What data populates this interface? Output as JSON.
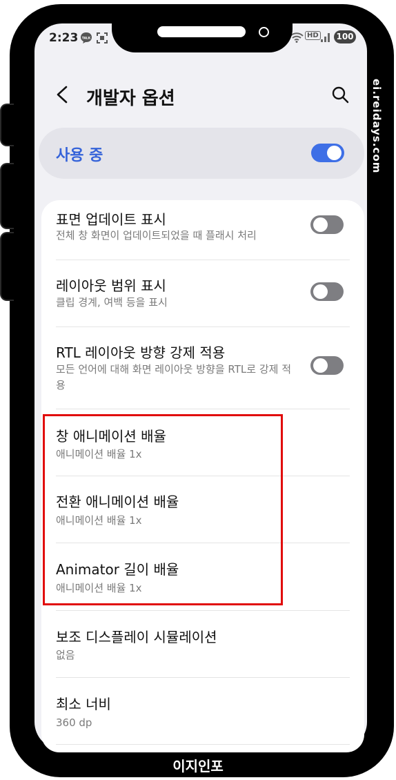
{
  "status_bar": {
    "time": "2:23",
    "talk_badge": "TALK",
    "hd_badge": "HD",
    "battery": "100"
  },
  "header": {
    "title": "개발자 옵션"
  },
  "master_switch": {
    "label": "사용 중",
    "state": "on"
  },
  "settings": [
    {
      "title": "표면 업데이트 표시",
      "subtitle": "전체 창 화면이 업데이트되었을 때 플래시 처리",
      "toggle": "off"
    },
    {
      "title": "레이아웃 범위 표시",
      "subtitle": "클립 경계, 여백 등을 표시",
      "toggle": "off"
    },
    {
      "title": "RTL 레이아웃 방향 강제 적용",
      "subtitle": "모든 언어에 대해 화면 레이아웃 방향을 RTL로 강제 적용",
      "toggle": "off"
    },
    {
      "title": "창 애니메이션 배율",
      "subtitle": "애니메이션 배율 1x"
    },
    {
      "title": "전환 애니메이션 배율",
      "subtitle": "애니메이션 배율 1x"
    },
    {
      "title": "Animator 길이 배율",
      "subtitle": "애니메이션 배율 1x"
    },
    {
      "title": "보조 디스플레이 시뮬레이션",
      "subtitle": "없음"
    },
    {
      "title": "최소 너비",
      "subtitle": "360 dp"
    }
  ],
  "watermark": "ei.reidays.com",
  "bottom_label": "이지인포",
  "colors": {
    "accent": "#3e6fe6",
    "highlight": "#e10a0a",
    "background": "#f1f1f5"
  }
}
